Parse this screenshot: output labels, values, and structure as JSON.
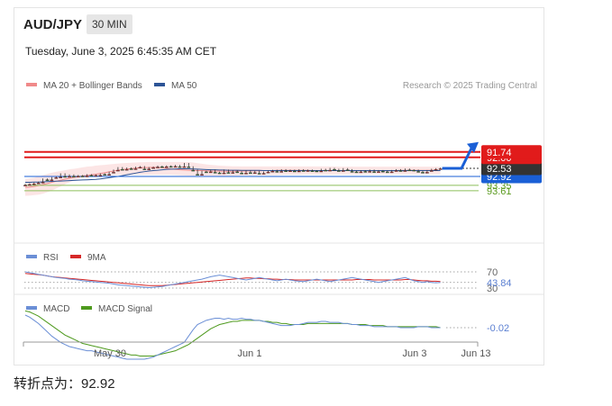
{
  "header": {
    "pair": "AUD/JPY",
    "timeframe": "30 MIN",
    "datetime": "Tuesday, June 3, 2025 6:45:35 AM CET"
  },
  "footer": {
    "text": "转折点为：92.92"
  },
  "colors": {
    "bollinger": "#f08a8a",
    "ma50": "#2c5496",
    "candle_up": "#2e7d32",
    "candle_down": "#c62828",
    "support": "#e11b1b",
    "pivot": "#1a5fd6",
    "last": "#333333",
    "resistance": "#8cbf5a",
    "rsi": "#6b8fd6",
    "rsi_ma": "#d62828",
    "macd": "#6b8fd6",
    "macd_signal": "#4e9a1e"
  },
  "chart_data": [
    {
      "type": "candlestick",
      "legend": [
        "MA 20 + Bollinger Bands",
        "MA 50"
      ],
      "source": "Research © 2025 Trading Central",
      "x_ticks": [
        "May 30",
        "Jun 1",
        "Jun 3",
        "Jun 13"
      ],
      "levels": [
        {
          "value": 93.61,
          "label": "93.61",
          "kind": "resistance"
        },
        {
          "value": 93.35,
          "label": "93.35",
          "kind": "resistance"
        },
        {
          "value": 92.92,
          "label": "92.92",
          "kind": "pivot"
        },
        {
          "value": 92.53,
          "label": "92.53",
          "kind": "last"
        },
        {
          "value": 92.0,
          "label": "92.00",
          "kind": "support"
        },
        {
          "value": 91.74,
          "label": "91.74",
          "kind": "support"
        }
      ],
      "close": [
        93.31,
        93.28,
        93.24,
        93.2,
        93.05,
        93.08,
        92.98,
        92.95,
        92.8,
        92.92,
        92.85,
        92.91,
        92.88,
        92.9,
        92.84,
        92.87,
        92.86,
        92.8,
        92.82,
        92.72,
        92.62,
        92.5,
        92.58,
        92.52,
        92.55,
        92.48,
        92.45,
        92.56,
        92.5,
        92.47,
        92.43,
        92.45,
        92.42,
        92.44,
        92.4,
        92.45,
        92.3,
        92.46,
        92.62,
        92.82,
        92.68,
        92.7,
        92.62,
        92.72,
        92.75,
        92.62,
        92.73,
        92.65,
        92.7,
        92.76,
        92.66,
        92.74,
        92.68,
        92.77,
        92.71,
        92.67,
        92.63,
        92.68,
        92.6,
        92.65,
        92.62,
        92.66,
        92.6,
        92.64,
        92.62,
        92.65,
        92.66,
        92.58,
        92.62,
        92.54,
        92.58,
        92.64,
        92.55,
        92.6,
        92.68,
        92.7,
        92.65,
        92.68,
        92.62,
        92.69,
        92.64,
        92.67,
        92.7,
        92.64,
        92.6,
        92.64,
        92.57,
        92.61,
        92.62,
        92.68,
        92.72,
        92.64,
        92.58,
        92.55,
        92.53
      ],
      "ma20": [
        93.45,
        93.43,
        93.4,
        93.36,
        93.31,
        93.26,
        93.2,
        93.15,
        93.1,
        93.05,
        93.01,
        92.97,
        92.93,
        92.9,
        92.87,
        92.84,
        92.81,
        92.78,
        92.74,
        92.7,
        92.66,
        92.62,
        92.59,
        92.56,
        92.54,
        92.52,
        92.5,
        92.49,
        92.49,
        92.48,
        92.48,
        92.5,
        92.53,
        92.56,
        92.58,
        92.6,
        92.61,
        92.62,
        92.63,
        92.64,
        92.64,
        92.65,
        92.66,
        92.66,
        92.66,
        92.67,
        92.67,
        92.67,
        92.66,
        92.66,
        92.66,
        92.65,
        92.65,
        92.65,
        92.64,
        92.64,
        92.64,
        92.63,
        92.63,
        92.63,
        92.63,
        92.63,
        92.63,
        92.63,
        92.63,
        92.64,
        92.64,
        92.64,
        92.64,
        92.64,
        92.64,
        92.64,
        92.64,
        92.64,
        92.64,
        92.64,
        92.64,
        92.64,
        92.64,
        92.64,
        92.64,
        92.64,
        92.64,
        92.64,
        92.64,
        92.63,
        92.63,
        92.63,
        92.63,
        92.63,
        92.63,
        92.63,
        92.62,
        92.61
      ],
      "bb_upper": [
        93.85,
        93.84,
        93.82,
        93.8,
        93.75,
        93.68,
        93.6,
        93.5,
        93.4,
        93.3,
        93.2,
        93.12,
        93.05,
        92.99,
        92.96,
        92.93,
        92.91,
        92.9,
        92.88,
        92.87,
        92.86,
        92.85,
        92.85,
        92.84,
        92.84,
        92.84,
        92.84,
        92.84,
        92.84,
        92.84,
        92.84,
        92.84,
        92.84,
        92.84,
        92.85,
        92.86,
        92.87,
        92.88,
        92.88,
        92.89,
        92.89,
        92.89,
        92.89,
        92.89,
        92.89,
        92.89,
        92.88,
        92.88,
        92.88,
        92.87,
        92.87,
        92.87,
        92.86,
        92.86,
        92.86,
        92.85,
        92.85,
        92.85,
        92.84,
        92.84,
        92.84,
        92.84,
        92.84,
        92.83,
        92.83,
        92.83,
        92.83,
        92.83,
        92.83,
        92.83,
        92.83,
        92.83,
        92.83,
        92.83,
        92.83,
        92.83,
        92.83,
        92.82,
        92.82,
        92.82,
        92.82,
        92.82,
        92.82,
        92.82,
        92.82,
        92.82,
        92.82,
        92.82,
        92.82,
        92.82,
        92.82,
        92.82,
        92.82,
        92.82,
        92.82
      ],
      "bb_lower": [
        93.05,
        93.02,
        92.98,
        92.92,
        92.86,
        92.8,
        92.74,
        92.7,
        92.66,
        92.62,
        92.58,
        92.55,
        92.52,
        92.48,
        92.45,
        92.43,
        92.4,
        92.38,
        92.36,
        92.34,
        92.32,
        92.3,
        92.28,
        92.27,
        92.26,
        92.25,
        92.24,
        92.23,
        92.22,
        92.22,
        92.22,
        92.22,
        92.22,
        92.22,
        92.22,
        92.22,
        92.22,
        92.23,
        92.25,
        92.28,
        92.31,
        92.34,
        92.36,
        92.38,
        92.4,
        92.41,
        92.42,
        92.43,
        92.43,
        92.44,
        92.44,
        92.44,
        92.44,
        92.44,
        92.44,
        92.44,
        92.44,
        92.44,
        92.44,
        92.44,
        92.44,
        92.44,
        92.44,
        92.44,
        92.44,
        92.44,
        92.44,
        92.44,
        92.44,
        92.44,
        92.44,
        92.45,
        92.45,
        92.45,
        92.45,
        92.45,
        92.45,
        92.45,
        92.45,
        92.45,
        92.45,
        92.45,
        92.45,
        92.45,
        92.45,
        92.45,
        92.45,
        92.45,
        92.45,
        92.45,
        92.45,
        92.45,
        92.45,
        92.45,
        92.45
      ],
      "ma50": [
        93.2,
        93.2,
        93.19,
        93.19,
        93.18,
        93.17,
        93.16,
        93.15,
        93.14,
        93.13,
        93.12,
        93.11,
        93.1,
        93.09,
        93.08,
        93.07,
        93.06,
        93.04,
        93.01,
        92.98,
        92.95,
        92.92,
        92.88,
        92.84,
        92.8,
        92.76,
        92.72,
        92.69,
        92.66,
        92.64,
        92.62,
        92.6,
        92.58,
        92.57,
        92.56,
        92.55,
        92.55,
        92.55,
        92.56,
        92.57,
        92.58,
        92.59,
        92.6,
        92.6,
        92.61,
        92.61,
        92.62,
        92.62,
        92.62,
        92.63,
        92.63,
        92.63,
        92.63,
        92.63,
        92.64,
        92.64,
        92.64,
        92.64,
        92.64,
        92.64,
        92.64,
        92.64,
        92.64,
        92.64,
        92.64,
        92.64,
        92.64,
        92.64,
        92.64,
        92.64,
        92.64,
        92.64,
        92.64,
        92.64,
        92.64,
        92.64,
        92.64,
        92.64,
        92.64,
        92.64,
        92.64,
        92.64,
        92.64,
        92.64,
        92.64,
        92.64,
        92.64,
        92.64,
        92.64,
        92.64,
        92.64,
        92.64,
        92.64,
        92.64,
        92.64
      ],
      "forecast": [
        92.53,
        91.74
      ]
    },
    {
      "type": "line",
      "legend": [
        "RSI",
        "9MA"
      ],
      "levels": [
        70,
        30
      ],
      "level_labels": [
        "70",
        "30"
      ],
      "last_value": "43.84",
      "rsi": [
        70,
        68,
        66,
        64,
        62,
        60,
        58,
        56,
        55,
        54,
        52,
        51,
        50,
        48,
        47,
        46,
        45,
        44,
        43,
        42,
        40,
        38,
        37,
        36,
        35,
        34,
        33,
        32,
        31,
        32,
        33,
        34,
        36,
        38,
        40,
        42,
        44,
        46,
        48,
        50,
        52,
        55,
        58,
        60,
        62,
        60,
        58,
        56,
        54,
        52,
        50,
        52,
        54,
        56,
        54,
        52,
        50,
        48,
        50,
        52,
        50,
        48,
        47,
        46,
        48,
        50,
        52,
        50,
        48,
        46,
        48,
        50,
        52,
        54,
        56,
        54,
        52,
        50,
        48,
        46,
        44,
        46,
        48,
        50,
        52,
        54,
        56,
        52,
        48,
        46,
        44,
        46,
        44,
        43,
        43.84
      ],
      "rsi_ma": [
        66,
        65,
        64,
        63,
        62,
        60,
        58,
        57,
        56,
        55,
        54,
        53,
        52,
        51,
        50,
        49,
        48,
        47,
        46,
        45,
        44,
        43,
        42,
        41,
        40,
        39,
        38,
        37,
        36,
        36,
        36,
        36,
        37,
        38,
        39,
        40,
        41,
        42,
        43,
        44,
        45,
        46,
        47,
        48,
        49,
        50,
        51,
        52,
        53,
        54,
        55,
        55,
        54,
        54,
        53,
        53,
        52,
        52,
        51,
        51,
        51,
        50,
        50,
        50,
        50,
        50,
        50,
        50,
        50,
        50,
        50,
        50,
        50,
        50,
        50,
        51,
        51,
        51,
        51,
        50,
        50,
        50,
        50,
        50,
        50,
        50,
        51,
        51,
        50,
        49,
        48,
        48,
        47,
        47,
        46
      ]
    },
    {
      "type": "line",
      "legend": [
        "MACD",
        "MACD Signal"
      ],
      "last_value": "-0.02",
      "macd": [
        0.1,
        0.08,
        0.05,
        0.02,
        -0.02,
        -0.06,
        -0.1,
        -0.13,
        -0.16,
        -0.18,
        -0.2,
        -0.21,
        -0.22,
        -0.23,
        -0.24,
        -0.24,
        -0.25,
        -0.26,
        -0.27,
        -0.28,
        -0.29,
        -0.3,
        -0.31,
        -0.32,
        -0.32,
        -0.32,
        -0.32,
        -0.32,
        -0.31,
        -0.3,
        -0.28,
        -0.26,
        -0.24,
        -0.22,
        -0.2,
        -0.18,
        -0.16,
        -0.1,
        -0.04,
        0.01,
        0.03,
        0.05,
        0.06,
        0.07,
        0.07,
        0.06,
        0.07,
        0.06,
        0.06,
        0.07,
        0.06,
        0.06,
        0.05,
        0.05,
        0.04,
        0.03,
        0.02,
        0.01,
        0.0,
        0.0,
        0.0,
        0.01,
        0.01,
        0.02,
        0.03,
        0.03,
        0.03,
        0.04,
        0.04,
        0.03,
        0.03,
        0.03,
        0.02,
        0.02,
        0.01,
        0.01,
        0.0,
        0.0,
        0.0,
        -0.01,
        -0.01,
        -0.01,
        -0.01,
        -0.01,
        -0.01,
        -0.02,
        -0.02,
        -0.02,
        -0.02,
        -0.01,
        -0.01,
        -0.01,
        -0.02,
        -0.02,
        -0.02
      ],
      "macd_signal": [
        0.14,
        0.13,
        0.11,
        0.09,
        0.06,
        0.03,
        0.0,
        -0.03,
        -0.06,
        -0.09,
        -0.11,
        -0.13,
        -0.15,
        -0.17,
        -0.18,
        -0.19,
        -0.2,
        -0.21,
        -0.22,
        -0.23,
        -0.24,
        -0.25,
        -0.26,
        -0.27,
        -0.28,
        -0.28,
        -0.29,
        -0.29,
        -0.29,
        -0.29,
        -0.28,
        -0.27,
        -0.26,
        -0.25,
        -0.24,
        -0.22,
        -0.2,
        -0.18,
        -0.15,
        -0.12,
        -0.09,
        -0.06,
        -0.03,
        -0.01,
        0.01,
        0.02,
        0.03,
        0.04,
        0.04,
        0.05,
        0.05,
        0.05,
        0.05,
        0.05,
        0.04,
        0.04,
        0.03,
        0.03,
        0.02,
        0.02,
        0.01,
        0.01,
        0.01,
        0.01,
        0.02,
        0.02,
        0.02,
        0.02,
        0.02,
        0.02,
        0.02,
        0.02,
        0.02,
        0.02,
        0.01,
        0.01,
        0.01,
        0.01,
        0.0,
        0.0,
        0.0,
        0.0,
        -0.01,
        -0.01,
        -0.01,
        -0.01,
        -0.01,
        -0.01,
        -0.01,
        -0.01,
        -0.01,
        -0.01,
        -0.01,
        -0.01,
        -0.02
      ]
    }
  ]
}
